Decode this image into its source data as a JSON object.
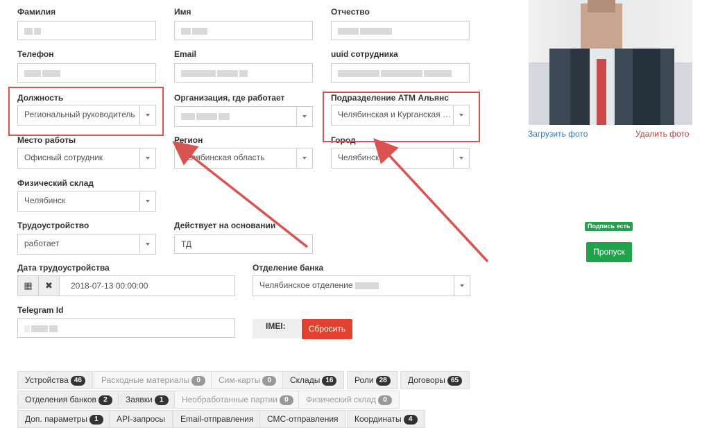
{
  "form": {
    "last_name": {
      "label": "Фамилия"
    },
    "first_name": {
      "label": "Имя"
    },
    "patronymic": {
      "label": "Отчество"
    },
    "phone": {
      "label": "Телефон"
    },
    "email": {
      "label": "Email"
    },
    "uuid": {
      "label": "uuid сотрудника"
    },
    "position": {
      "label": "Должность",
      "value": "Региональный руководитель"
    },
    "organization": {
      "label": "Организация, где работает"
    },
    "division": {
      "label": "Подразделение АТМ Альянс",
      "value": "Челябинская и Курганская о..."
    },
    "workplace": {
      "label": "Место работы",
      "value": "Офисный сотрудник"
    },
    "region": {
      "label": "Регион",
      "value": "Челябинская область"
    },
    "city": {
      "label": "Город",
      "value": "Челябинск"
    },
    "warehouse": {
      "label": "Физический склад",
      "value": "Челябинск"
    },
    "employment": {
      "label": "Трудоустройство",
      "value": "работает"
    },
    "basis": {
      "label": "Действует на основании",
      "value": "ТД"
    },
    "employment_date": {
      "label": "Дата трудоустройства",
      "value": "2018-07-13 00:00:00"
    },
    "bank_branch": {
      "label": "Отделение банка",
      "value": "Челябинское отделение"
    },
    "telegram": {
      "label": "Telegram Id"
    },
    "imei": {
      "label": "IMEI:",
      "reset_label": "Сбросить"
    }
  },
  "photo": {
    "upload_label": "Загрузить фото",
    "delete_label": "Удалить фото"
  },
  "status": {
    "signature_badge": "Подпись есть",
    "pass_button": "Пропуск"
  },
  "tabs": [
    {
      "label": "Устройства",
      "count": "46",
      "enabled": true
    },
    {
      "label": "Расходные материалы",
      "count": "0",
      "enabled": false
    },
    {
      "label": "Сим-карты",
      "count": "0",
      "enabled": false
    },
    {
      "label": "Склады",
      "count": "16",
      "enabled": true
    },
    {
      "label": "Роли",
      "count": "28",
      "enabled": true
    },
    {
      "label": "Договоры",
      "count": "65",
      "enabled": true
    },
    {
      "label": "Отделения банков",
      "count": "2",
      "enabled": true
    },
    {
      "label": "Заявки",
      "count": "1",
      "enabled": true
    },
    {
      "label": "Необработанные партии",
      "count": "0",
      "enabled": false
    },
    {
      "label": "Физический склад",
      "count": "0",
      "enabled": false
    },
    {
      "label": "Доп. параметры",
      "count": "1",
      "enabled": true
    },
    {
      "label": "API-запросы",
      "count": "",
      "enabled": true
    },
    {
      "label": "Email-отправления",
      "count": "",
      "enabled": true
    },
    {
      "label": "СМС-отправления",
      "count": "",
      "enabled": true
    },
    {
      "label": "Координаты",
      "count": "4",
      "enabled": true
    }
  ],
  "colors": {
    "annotation_red": "#d9534f",
    "link_blue": "#337ab7",
    "link_red": "#a94442",
    "success_green": "#1fa24a",
    "danger_red": "#e0422f"
  }
}
